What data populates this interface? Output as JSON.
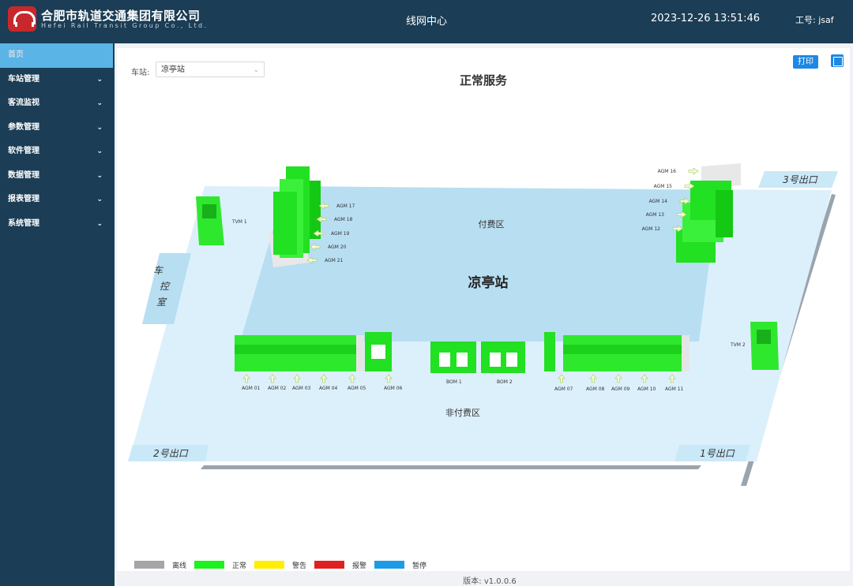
{
  "header": {
    "company_cn": "合肥市轨道交通集团有限公司",
    "company_en": "Hefei Rail Transit Group Co., Ltd.",
    "center_title": "线网中心",
    "datetime": "2023-12-26 13:51:46",
    "user": "工号: jsaf"
  },
  "sidebar": {
    "items": [
      {
        "label": "首页",
        "active": true
      },
      {
        "label": "车站管理",
        "chevron": "chevron-down-icon"
      },
      {
        "label": "客流监视",
        "chevron": "chevron-down-icon"
      },
      {
        "label": "参数管理",
        "chevron": "chevron-down-icon"
      },
      {
        "label": "软件管理",
        "chevron": "chevron-down-icon"
      },
      {
        "label": "数据管理",
        "chevron": "chevron-down-icon"
      },
      {
        "label": "报表管理",
        "chevron": "chevron-down-icon"
      },
      {
        "label": "系统管理",
        "chevron": "chevron-down-icon"
      }
    ]
  },
  "toolbar": {
    "station_label": "车站:",
    "station_value": "凉亭站",
    "status_title": "正常服务",
    "print_label": "打印"
  },
  "map": {
    "station_name": "凉亭站",
    "paid_area": "付费区",
    "unpaid_area": "非付费区",
    "control_room": [
      "车",
      "控",
      "室"
    ],
    "exits": {
      "exit1": "1号出口",
      "exit2": "2号出口",
      "exit3": "3号出口"
    },
    "tvm": [
      "TVM 1",
      "TVM 2"
    ],
    "bom": [
      "BOM 1",
      "BOM 2"
    ],
    "agm_bottom_left": [
      "AGM 01",
      "AGM 02",
      "AGM 03",
      "AGM 04",
      "AGM 05",
      "AGM 06"
    ],
    "agm_bottom_right": [
      "AGM 07",
      "AGM 08",
      "AGM 09",
      "AGM 10",
      "AGM 11"
    ],
    "agm_top_left": [
      "AGM 17",
      "AGM 18",
      "AGM 19",
      "AGM 20",
      "AGM 21"
    ],
    "agm_top_right": [
      "AGM 16",
      "AGM 15",
      "AGM 14",
      "AGM 13",
      "AGM 12"
    ]
  },
  "legend": [
    {
      "label": "离线",
      "color": "#a6a6a6"
    },
    {
      "label": "正常",
      "color": "#1df21d"
    },
    {
      "label": "警告",
      "color": "#ffee00"
    },
    {
      "label": "报警",
      "color": "#e02020"
    },
    {
      "label": "暂停",
      "color": "#1e9be6"
    }
  ],
  "colors": {
    "accent": "#1e88e5",
    "header_bg": "#1b3d55",
    "sidebar_active": "#5ab4e6",
    "paid_area": "#b8def2",
    "unpaid_area": "#dcf0fb",
    "device_normal": "#1df21d"
  },
  "footer": {
    "version": "版本: v1.0.0.6"
  }
}
